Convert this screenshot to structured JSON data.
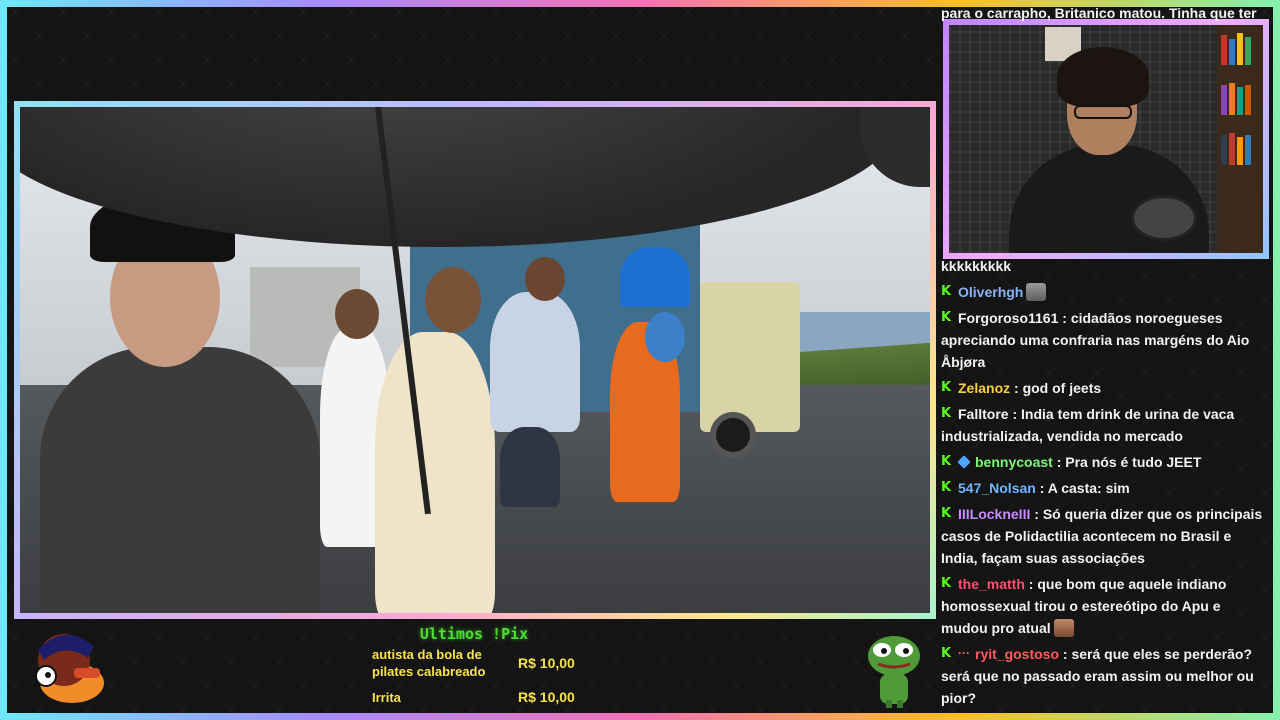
{
  "chat": {
    "top_partial": "para o carrapho, Britanico matou. Tinha que ter",
    "messages": [
      {
        "user": "",
        "user_color": "#f2f2f2",
        "text": "kkkkkkkkk",
        "badge": "none",
        "emote": "none"
      },
      {
        "user": "Oliverhgh",
        "user_color": "#8ab4f8",
        "text": "",
        "badge": "kick-badge",
        "emote": "cat-emote"
      },
      {
        "user": "Forgoroso1161",
        "user_color": "#f2f2f2",
        "text": "cidadãos noroegueses apreciando uma confraria nas margéns do Aio Åbjøra",
        "badge": "kick-badge",
        "emote": "none"
      },
      {
        "user": "Zelanoz",
        "user_color": "#f5d142",
        "text": "god of jeets",
        "badge": "kick-badge",
        "emote": "none"
      },
      {
        "user": "Falltore",
        "user_color": "#f2f2f2",
        "text": "India tem drink de urina de vaca industrializada, vendida no mercado",
        "badge": "kick-badge",
        "emote": "none"
      },
      {
        "user": "bennycoast",
        "user_color": "#7cf77a",
        "text": "Pra nós é tudo JEET",
        "badge": "kick-cube-badge",
        "emote": "none"
      },
      {
        "user": "547_Nolsan",
        "user_color": "#6fb6ff",
        "text": "A casta: sim",
        "badge": "kick-badge",
        "emote": "none"
      },
      {
        "user": "IIILockneIII",
        "user_color": "#c98bff",
        "text": "Só queria dizer que os principais casos de Polidactilia acontecem no Brasil e India, façam suas associações",
        "badge": "kick-badge",
        "emote": "none"
      },
      {
        "user": "the_matth",
        "user_color": "#ff4d6d",
        "text": "que bom que aquele indiano homossexual tirou o estereótipo do Apu e mudou pro atual",
        "badge": "kick-badge",
        "emote": "face-emote"
      },
      {
        "user": "ryit_gostoso",
        "user_color": "#ff5a5a",
        "text": "será que eles se perderão? será que no passado eram assim ou melhor ou pior?",
        "badge": "kick-dots-badge",
        "emote": "none"
      }
    ]
  },
  "pix": {
    "title": "Ultimos !Pix",
    "entries": [
      {
        "name": "autista da bola de pilates calabreado",
        "amount": "R$ 10,00"
      },
      {
        "name": "Irrita",
        "amount": "R$ 10,00"
      }
    ]
  },
  "colors": {
    "kick_green": "#53fc18",
    "pix_yellow": "#f7e34d",
    "pix_title_green": "#4ade2e"
  },
  "icons": {
    "mascot_left": "cartoon-character-icon",
    "mascot_right": "pepe-frog-icon"
  }
}
